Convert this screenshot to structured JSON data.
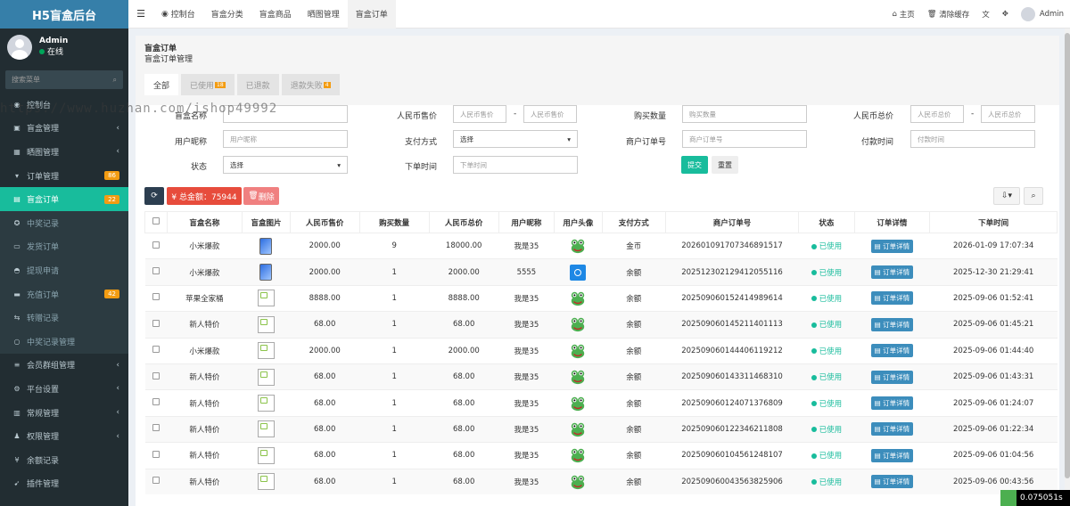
{
  "brand": "H5盲盒后台",
  "user": {
    "name": "Admin",
    "status": "在线"
  },
  "sidebar": {
    "search_placeholder": "搜索菜单",
    "items": [
      {
        "label": "控制台",
        "icon": "dashboard-icon"
      },
      {
        "label": "盲盒管理",
        "icon": "box-icon",
        "chevron": "‹"
      },
      {
        "label": "晒图管理",
        "icon": "image-icon",
        "chevron": "‹"
      },
      {
        "label": "订单管理",
        "icon": "cart-icon",
        "badge": "86"
      },
      {
        "label": "盲盒订单",
        "icon": "calendar-icon",
        "badge": "22",
        "current": true
      },
      {
        "label": "中奖记录",
        "icon": "gift-icon",
        "sub": true
      },
      {
        "label": "发货订单",
        "icon": "truck-icon",
        "sub": true
      },
      {
        "label": "提现申请",
        "icon": "chat-icon",
        "sub": true
      },
      {
        "label": "充值订单",
        "icon": "credit-card-icon",
        "badge": "42",
        "sub": true
      },
      {
        "label": "转赠记录",
        "icon": "transfer-icon",
        "sub": true
      },
      {
        "label": "中奖记录管理",
        "icon": "circle-icon",
        "sub": true
      },
      {
        "label": "会员群组管理",
        "icon": "list-icon",
        "chevron": "‹"
      },
      {
        "label": "平台设置",
        "icon": "settings-icon",
        "chevron": "‹"
      },
      {
        "label": "常规管理",
        "icon": "folder-icon",
        "chevron": "‹"
      },
      {
        "label": "权限管理",
        "icon": "users-icon",
        "chevron": "‹"
      },
      {
        "label": "余额记录",
        "icon": "yen-icon"
      },
      {
        "label": "插件管理",
        "icon": "rocket-icon"
      }
    ]
  },
  "header": {
    "nav": [
      "控制台",
      "盲盒分类",
      "盲盒商品",
      "晒图管理",
      "盲盒订单"
    ],
    "active_nav": 4,
    "right": {
      "home": "主页",
      "clear_cache": "清除缓存",
      "user": "Admin"
    }
  },
  "page": {
    "title": "盲盒订单",
    "subtitle": "盲盒订单管理"
  },
  "tabs": [
    {
      "label": "全部",
      "active": true
    },
    {
      "label": "已使用",
      "badge": "18"
    },
    {
      "label": "已退款"
    },
    {
      "label": "退款失败",
      "badge": "4"
    }
  ],
  "filters": {
    "box_name_label": "盲盒名称",
    "rmb_price_label": "人民币售价",
    "rmb_price_ph": "人民币售价",
    "qty_label": "购买数量",
    "qty_ph": "购买数量",
    "rmb_total_label": "人民币总价",
    "rmb_total_ph": "人民币总价",
    "nickname_label": "用户昵称",
    "nickname_ph": "用户昵称",
    "pay_label": "支付方式",
    "pay_value": "选择",
    "merchant_label": "商户订单号",
    "merchant_ph": "商户订单号",
    "paytime_label": "付款时间",
    "paytime_ph": "付款时间",
    "status_label": "状态",
    "status_value": "选择",
    "ordertime_label": "下单时间",
    "ordertime_ph": "下单时间",
    "submit": "提交",
    "reset": "重置",
    "dash": "-"
  },
  "toolbar": {
    "total_label": "¥ 总金额：75944",
    "delete_label": "删除"
  },
  "table": {
    "headers": [
      "盲盒名称",
      "盲盒图片",
      "人民币售价",
      "购买数量",
      "人民币总价",
      "用户昵称",
      "用户头像",
      "支付方式",
      "商户订单号",
      "状态",
      "订单详情",
      "下单时间"
    ],
    "rows": [
      {
        "name": "小米爆款",
        "img": "phone",
        "price": "2000.00",
        "qty": "9",
        "total": "18000.00",
        "nick": "我是35",
        "avatar": "frog",
        "pay": "金币",
        "order": "20260109170734689151 7",
        "status": "已使用",
        "detail": "订单详情",
        "time": "2026-01-09 17:07:34"
      },
      {
        "name": "小米爆款",
        "img": "phone",
        "price": "2000.00",
        "qty": "1",
        "total": "2000.00",
        "nick": "5555",
        "avatar": "blue",
        "pay": "余额",
        "order": "202512302129412055116",
        "status": "已使用",
        "detail": "订单详情",
        "time": "2025-12-30 21:29:41"
      },
      {
        "name": "苹果全家桶",
        "img": "broken",
        "price": "8888.00",
        "qty": "1",
        "total": "8888.00",
        "nick": "我是35",
        "avatar": "frog",
        "pay": "余额",
        "order": "202509060152414989614",
        "status": "已使用",
        "detail": "订单详情",
        "time": "2025-09-06 01:52:41"
      },
      {
        "name": "新人特价",
        "img": "broken",
        "price": "68.00",
        "qty": "1",
        "total": "68.00",
        "nick": "我是35",
        "avatar": "frog",
        "pay": "余额",
        "order": "202509060145211401113",
        "status": "已使用",
        "detail": "订单详情",
        "time": "2025-09-06 01:45:21"
      },
      {
        "name": "小米爆款",
        "img": "broken",
        "price": "2000.00",
        "qty": "1",
        "total": "2000.00",
        "nick": "我是35",
        "avatar": "frog",
        "pay": "余额",
        "order": "202509060144406119212",
        "status": "已使用",
        "detail": "订单详情",
        "time": "2025-09-06 01:44:40"
      },
      {
        "name": "新人特价",
        "img": "broken",
        "price": "68.00",
        "qty": "1",
        "total": "68.00",
        "nick": "我是35",
        "avatar": "frog",
        "pay": "余额",
        "order": "202509060143311468310",
        "status": "已使用",
        "detail": "订单详情",
        "time": "2025-09-06 01:43:31"
      },
      {
        "name": "新人特价",
        "img": "broken",
        "price": "68.00",
        "qty": "1",
        "total": "68.00",
        "nick": "我是35",
        "avatar": "frog",
        "pay": "余额",
        "order": "202509060124071376809",
        "status": "已使用",
        "detail": "订单详情",
        "time": "2025-09-06 01:24:07"
      },
      {
        "name": "新人特价",
        "img": "broken",
        "price": "68.00",
        "qty": "1",
        "total": "68.00",
        "nick": "我是35",
        "avatar": "frog",
        "pay": "余额",
        "order": "202509060122346211808",
        "status": "已使用",
        "detail": "订单详情",
        "time": "2025-09-06 01:22:34"
      },
      {
        "name": "新人特价",
        "img": "broken",
        "price": "68.00",
        "qty": "1",
        "total": "68.00",
        "nick": "我是35",
        "avatar": "frog",
        "pay": "余额",
        "order": "202509060104561248107",
        "status": "已使用",
        "detail": "订单详情",
        "time": "2025-09-06 01:04:56"
      },
      {
        "name": "新人特价",
        "img": "broken",
        "price": "68.00",
        "qty": "1",
        "total": "68.00",
        "nick": "我是35",
        "avatar": "frog",
        "pay": "余额",
        "order": "202509060043563825906",
        "status": "已使用",
        "detail": "订单详情",
        "time": "2025-09-06 00:43:56"
      }
    ]
  },
  "watermark": "https://www.huzhan.com/ishop49992",
  "timer": "0.075051s"
}
